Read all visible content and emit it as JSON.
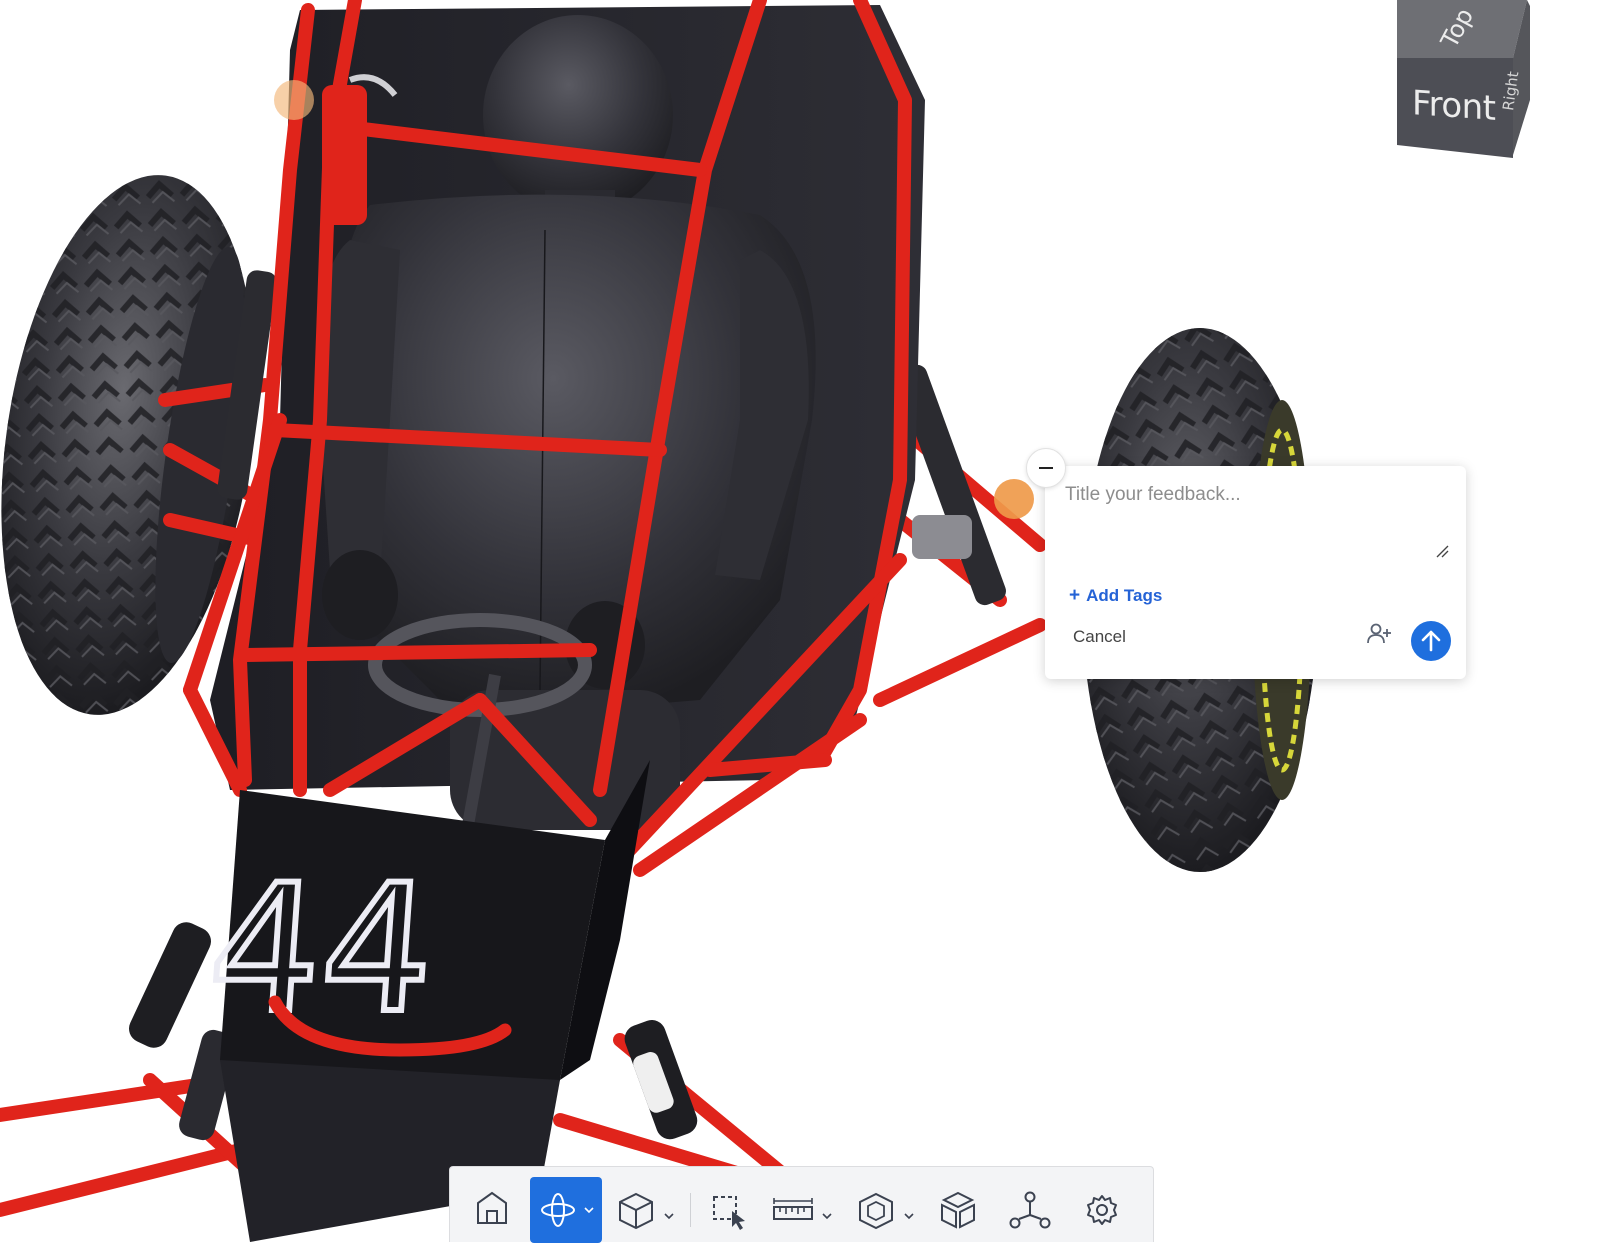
{
  "scene": {
    "car_number": "44",
    "view_cube": {
      "front": "Front",
      "top": "Top",
      "right": "Right"
    }
  },
  "feedback": {
    "title_placeholder": "Title your feedback...",
    "add_tags_label": "Add Tags",
    "add_tags_icon": "plus-icon",
    "cancel_label": "Cancel",
    "add_people_icon": "add-person-icon",
    "submit_icon": "arrow-up-icon"
  },
  "toolbar": {
    "tools": [
      {
        "icon": "home-icon",
        "active": false,
        "dropdown": false
      },
      {
        "icon": "orbit-icon",
        "active": true,
        "dropdown": true
      },
      {
        "icon": "cube-view-icon",
        "active": false,
        "dropdown": true
      },
      {
        "icon": "box-select-icon",
        "active": false,
        "dropdown": false
      },
      {
        "icon": "ruler-icon",
        "active": false,
        "dropdown": true
      },
      {
        "icon": "section-cube-icon",
        "active": false,
        "dropdown": true
      },
      {
        "icon": "explode-icon",
        "active": false,
        "dropdown": false
      },
      {
        "icon": "model-tree-icon",
        "active": false,
        "dropdown": false
      },
      {
        "icon": "settings-icon",
        "active": false,
        "dropdown": false
      }
    ]
  },
  "colors": {
    "accent": "#1f6fde",
    "frame_red": "#e0241b",
    "body_dark": "#24242a",
    "marker_orange": "#ef9a4a"
  }
}
